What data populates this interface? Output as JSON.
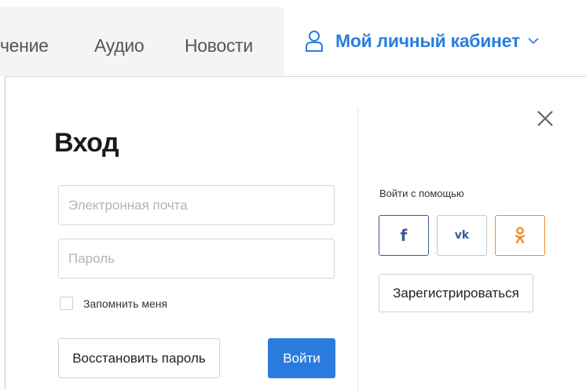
{
  "nav": {
    "items": [
      {
        "label": "чение"
      },
      {
        "label": "Аудио"
      },
      {
        "label": "Новости"
      }
    ],
    "cabinet_label": "Мой личный кабинет"
  },
  "login": {
    "title": "Вход",
    "email_placeholder": "Электронная почта",
    "password_placeholder": "Пароль",
    "remember_label": "Запомнить меня",
    "remember_checked": false,
    "restore_button": "Восстановить пароль",
    "login_button": "Войти"
  },
  "social": {
    "title": "Войти с помощью",
    "buttons": [
      {
        "glyph": "f",
        "icon": "facebook-icon",
        "color": "#3b5998"
      },
      {
        "glyph": "vk",
        "icon": "vk-icon",
        "color": "#3b5998"
      },
      {
        "glyph": "ok",
        "icon": "odnoklassniki-icon",
        "color": "#f08b2a"
      }
    ],
    "register_button": "Зарегистрироваться"
  },
  "colors": {
    "accent": "#2b7bde",
    "link": "#2a7de1"
  }
}
